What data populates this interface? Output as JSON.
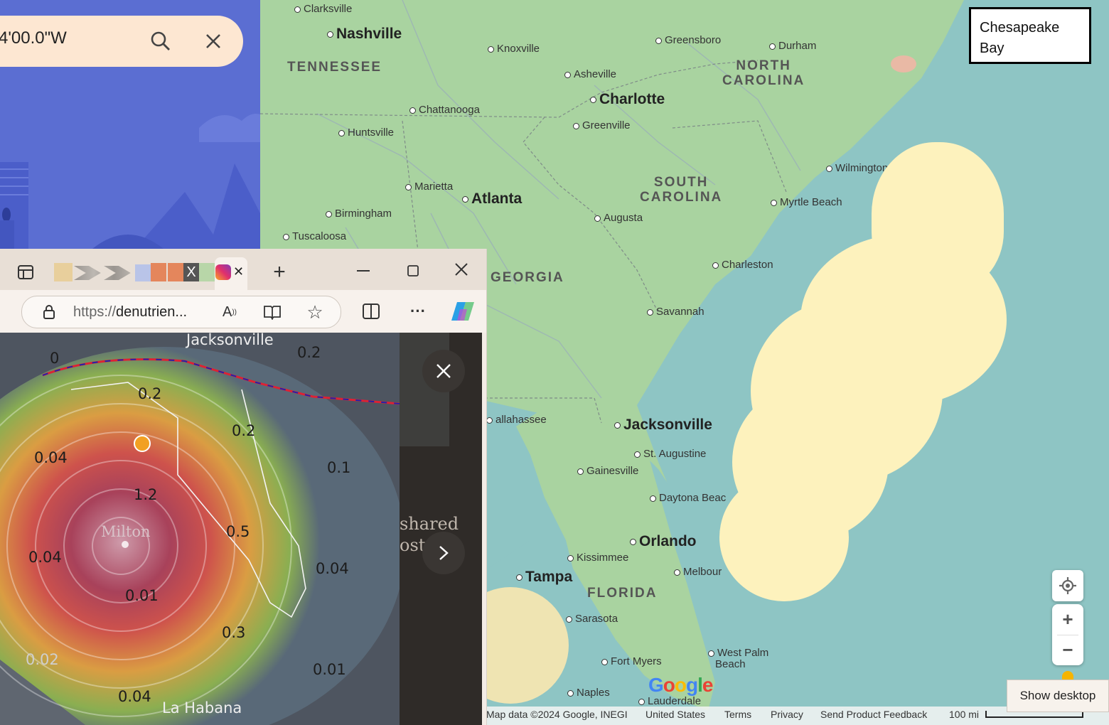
{
  "search": {
    "value": "4'00.0\"W"
  },
  "browser": {
    "url": "https://denutrien...",
    "url_scheme": "https://",
    "url_rest": "denutrien..."
  },
  "map": {
    "cities": [
      {
        "name": "Clarksville",
        "big": false
      },
      {
        "name": "Nashville",
        "big": true
      },
      {
        "name": "Knoxville",
        "big": false
      },
      {
        "name": "Greensboro",
        "big": false
      },
      {
        "name": "Durham",
        "big": false
      },
      {
        "name": "Asheville",
        "big": false
      },
      {
        "name": "Charlotte",
        "big": true
      },
      {
        "name": "Chattanooga",
        "big": false
      },
      {
        "name": "Huntsville",
        "big": false
      },
      {
        "name": "Greenville",
        "big": false
      },
      {
        "name": "Wilmington",
        "big": false
      },
      {
        "name": "Marietta",
        "big": false
      },
      {
        "name": "Atlanta",
        "big": true
      },
      {
        "name": "Myrtle Beach",
        "big": false
      },
      {
        "name": "Birmingham",
        "big": false
      },
      {
        "name": "Augusta",
        "big": false
      },
      {
        "name": "Tuscaloosa",
        "big": false
      },
      {
        "name": "Charleston",
        "big": false
      },
      {
        "name": "Savannah",
        "big": false
      },
      {
        "name": "allahassee",
        "big": false
      },
      {
        "name": "Jacksonville",
        "big": true
      },
      {
        "name": "St. Augustine",
        "big": false
      },
      {
        "name": "Gainesville",
        "big": false
      },
      {
        "name": "Daytona Beac",
        "big": false
      },
      {
        "name": "Orlando",
        "big": true
      },
      {
        "name": "Kissimmee",
        "big": false
      },
      {
        "name": "Melbour",
        "big": false
      },
      {
        "name": "Tampa",
        "big": true
      },
      {
        "name": "Sarasota",
        "big": false
      },
      {
        "name": "Fort Myers",
        "big": false
      },
      {
        "name": "Naples",
        "big": false
      },
      {
        "name": "West Palm",
        "big": false
      },
      {
        "name": "Beach",
        "big": false
      },
      {
        "name": "Lauderdale",
        "big": false
      }
    ],
    "states": [
      "TENNESSEE",
      "NORTH CAROLINA",
      "SOUTH CAROLINA",
      "GEORGIA",
      "FLORIDA"
    ],
    "state_lines": {
      "nc": [
        "NORTH",
        "CAROLINA"
      ],
      "sc": [
        "SOUTH",
        "CAROLINA"
      ]
    },
    "bay_label": "Chesapeake Bay",
    "bay_lines": [
      "Chesapeake",
      "Bay"
    ],
    "logo": "Google"
  },
  "weather": {
    "labels": [
      "Jacksonville",
      "0.2",
      "0",
      "0.2",
      "0.2",
      "0.04",
      "0.1",
      "1.2",
      "Milton",
      "0.5",
      "0.04",
      "0.04",
      "0.01",
      "0.3",
      "0.02",
      "0.01",
      "0.04",
      "La Habana"
    ],
    "side_text": [
      "shared",
      "ost"
    ]
  },
  "footer": {
    "map_data": "Map data ©2024 Google, INEGI",
    "country": "United States",
    "terms": "Terms",
    "privacy": "Privacy",
    "feedback": "Send Product Feedback",
    "scale": "100 mi"
  },
  "tooltip": "Show desktop",
  "colors": {
    "water": "#8ec5c4",
    "land": "#a9d3a0",
    "blob": "#fdf2bd",
    "panel_blue": "#5b6ed2",
    "search_bg": "#fde7d2"
  }
}
